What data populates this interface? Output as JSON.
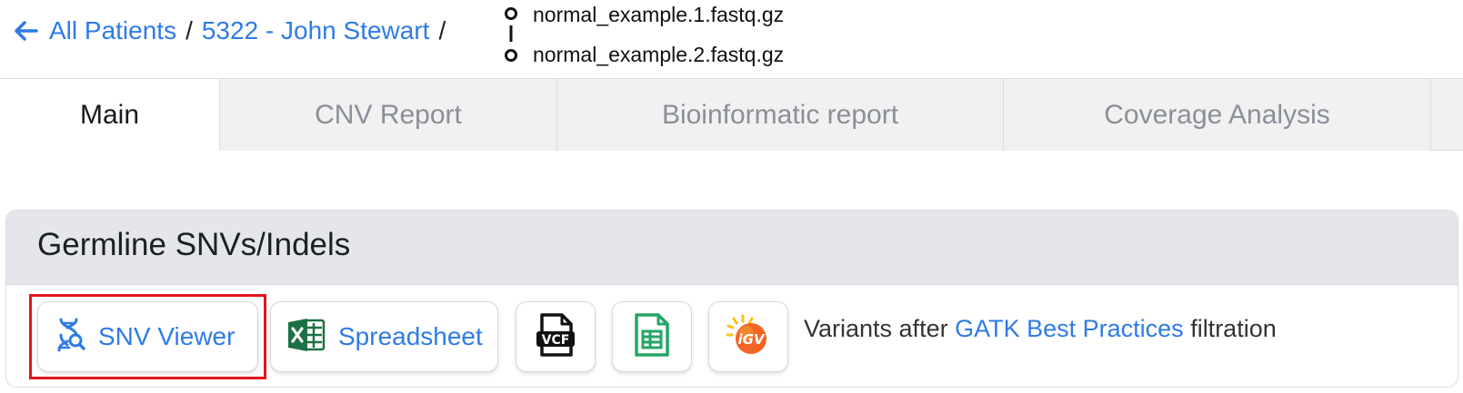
{
  "breadcrumb": {
    "back_icon": "arrow-left-icon",
    "all_patients": "All Patients",
    "separator": "/",
    "patient": "5322 - John Stewart",
    "files": [
      "normal_example.1.fastq.gz",
      "normal_example.2.fastq.gz"
    ]
  },
  "tabs": [
    {
      "label": "Main",
      "active": true
    },
    {
      "label": "CNV Report",
      "active": false
    },
    {
      "label": "Bioinformatic report",
      "active": false
    },
    {
      "label": "Coverage Analysis",
      "active": false
    }
  ],
  "card": {
    "title": "Germline SNVs/Indels",
    "buttons": {
      "snv_viewer": {
        "label": "SNV Viewer",
        "icon": "dna-search-icon"
      },
      "spreadsheet": {
        "label": "Spreadsheet",
        "icon": "excel-icon"
      },
      "vcf": {
        "icon": "vcf-file-icon",
        "icon_text": "VCF"
      },
      "google_sheets": {
        "icon": "google-sheets-icon"
      },
      "igv": {
        "icon": "igv-icon",
        "icon_text": "iGV"
      }
    },
    "description": {
      "prefix": "Variants after",
      "link": "GATK Best Practices",
      "suffix": "filtration"
    }
  },
  "colors": {
    "link": "#2f7be5",
    "highlight": "#e3141c",
    "excel_green": "#1d7044",
    "sheets_green": "#23a566",
    "igv_orange": "#f26522"
  }
}
